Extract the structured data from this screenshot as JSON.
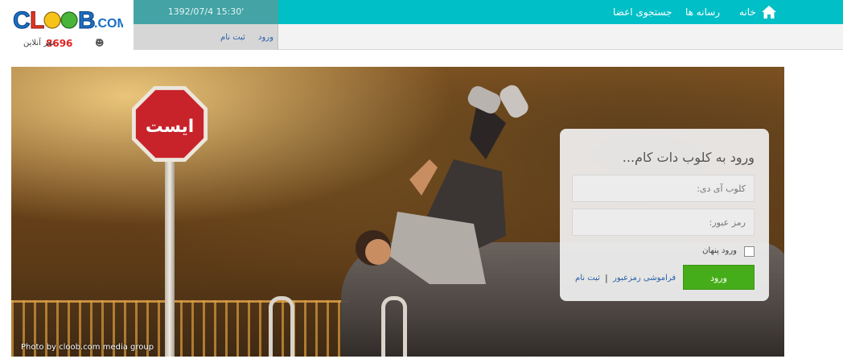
{
  "header": {
    "logo_text": "CLOOB.COM",
    "online_count": "8696",
    "online_label": "نفر آنلاین",
    "date_time": "1392/07/4 15:30'",
    "login_link": "ورود",
    "signup_link": "ثبت نام"
  },
  "nav": {
    "home": "خانه",
    "media": "رسانه ها",
    "search_members": "جستجوی اعضا"
  },
  "hero": {
    "stop_sign_text": "ایست",
    "photo_credit": "Photo by cloob.com media group"
  },
  "login_panel": {
    "title": "ورود به کلوب دات کام...",
    "id_placeholder": "کلوب آی دی:",
    "password_placeholder": "رمز عبور:",
    "hidden_login_label": "ورود پنهان",
    "submit_label": "ورود",
    "forgot_password": "فراموشی رمزعبور",
    "separator": "|",
    "signup": "ثبت نام"
  },
  "colors": {
    "teal": "#00bfc6",
    "date_bg": "#43a3a5",
    "green_button": "#46ad1a",
    "link_blue": "#2a5fa8",
    "online_red": "#e52020"
  }
}
